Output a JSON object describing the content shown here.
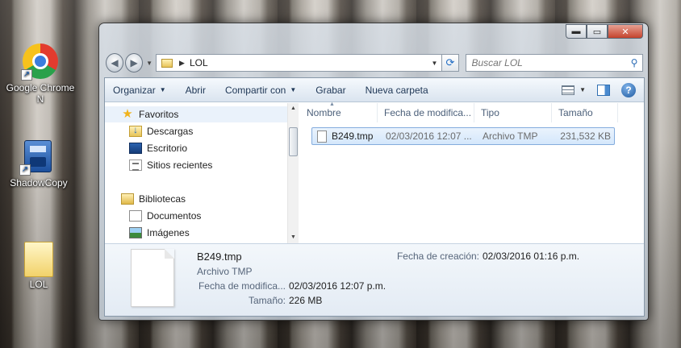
{
  "desktop": {
    "icons": [
      {
        "label": "Google Chrome N",
        "icon": "chrome-icon"
      },
      {
        "label": "ShadowCopy",
        "icon": "shadowcopy-icon"
      },
      {
        "label": "LOL",
        "icon": "folder-icon"
      }
    ]
  },
  "window": {
    "caption_buttons": {
      "minimize": "▬",
      "maximize": "▭",
      "close": "✕"
    },
    "address": {
      "path": "LOL"
    },
    "search": {
      "placeholder": "Buscar LOL"
    },
    "toolbar": {
      "organize": "Organizar",
      "open": "Abrir",
      "share": "Compartir con",
      "burn": "Grabar",
      "new_folder": "Nueva carpeta"
    },
    "nav": {
      "favorites": "Favoritos",
      "downloads": "Descargas",
      "desktop": "Escritorio",
      "recent": "Sitios recientes",
      "libraries": "Bibliotecas",
      "documents": "Documentos",
      "images": "Imágenes"
    },
    "columns": {
      "name": "Nombre",
      "modified": "Fecha de modifica...",
      "type": "Tipo",
      "size": "Tamaño"
    },
    "files": [
      {
        "name": "B249.tmp",
        "modified": "02/03/2016 12:07 ...",
        "type": "Archivo TMP",
        "size": "231,532 KB"
      }
    ],
    "details": {
      "name": "B249.tmp",
      "type": "Archivo TMP",
      "modified_label": "Fecha de modifica...",
      "modified_value": "02/03/2016 12:07 p.m.",
      "size_label": "Tamaño:",
      "size_value": "226 MB",
      "created_label": "Fecha de creación:",
      "created_value": "02/03/2016 01:16 p.m."
    }
  }
}
